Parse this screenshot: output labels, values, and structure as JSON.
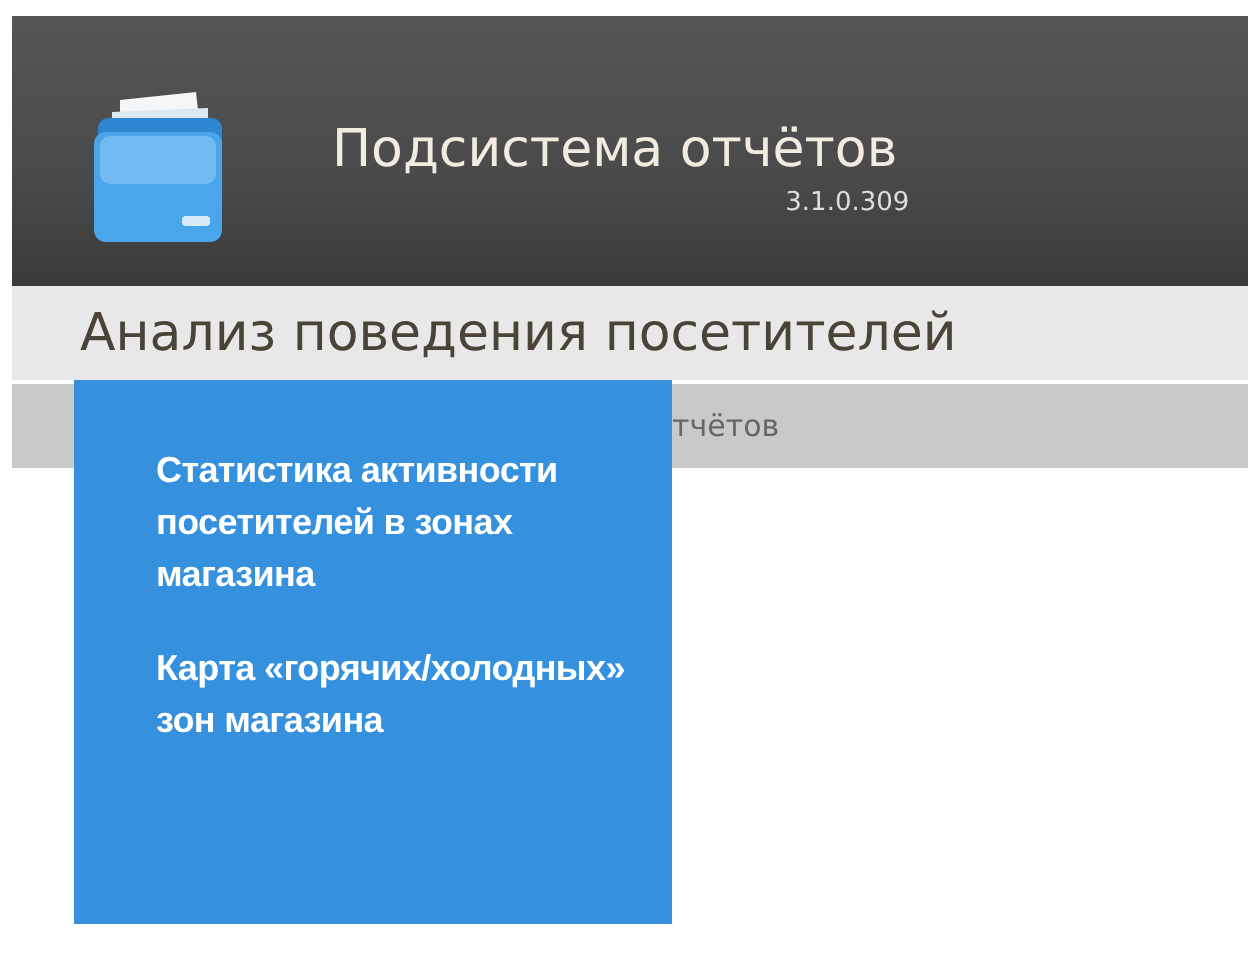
{
  "header": {
    "title": "Подсистема отчётов",
    "version": "3.1.0.309"
  },
  "menu_bar": {
    "title": "Анализ поведения посетителей"
  },
  "sub_bar": {
    "text": "тчётов"
  },
  "dropdown": {
    "items": [
      {
        "label": "Статистика активности посетителей в зонах магазина"
      },
      {
        "label": "Карта «горячих/холодных» зон магазина"
      }
    ]
  }
}
